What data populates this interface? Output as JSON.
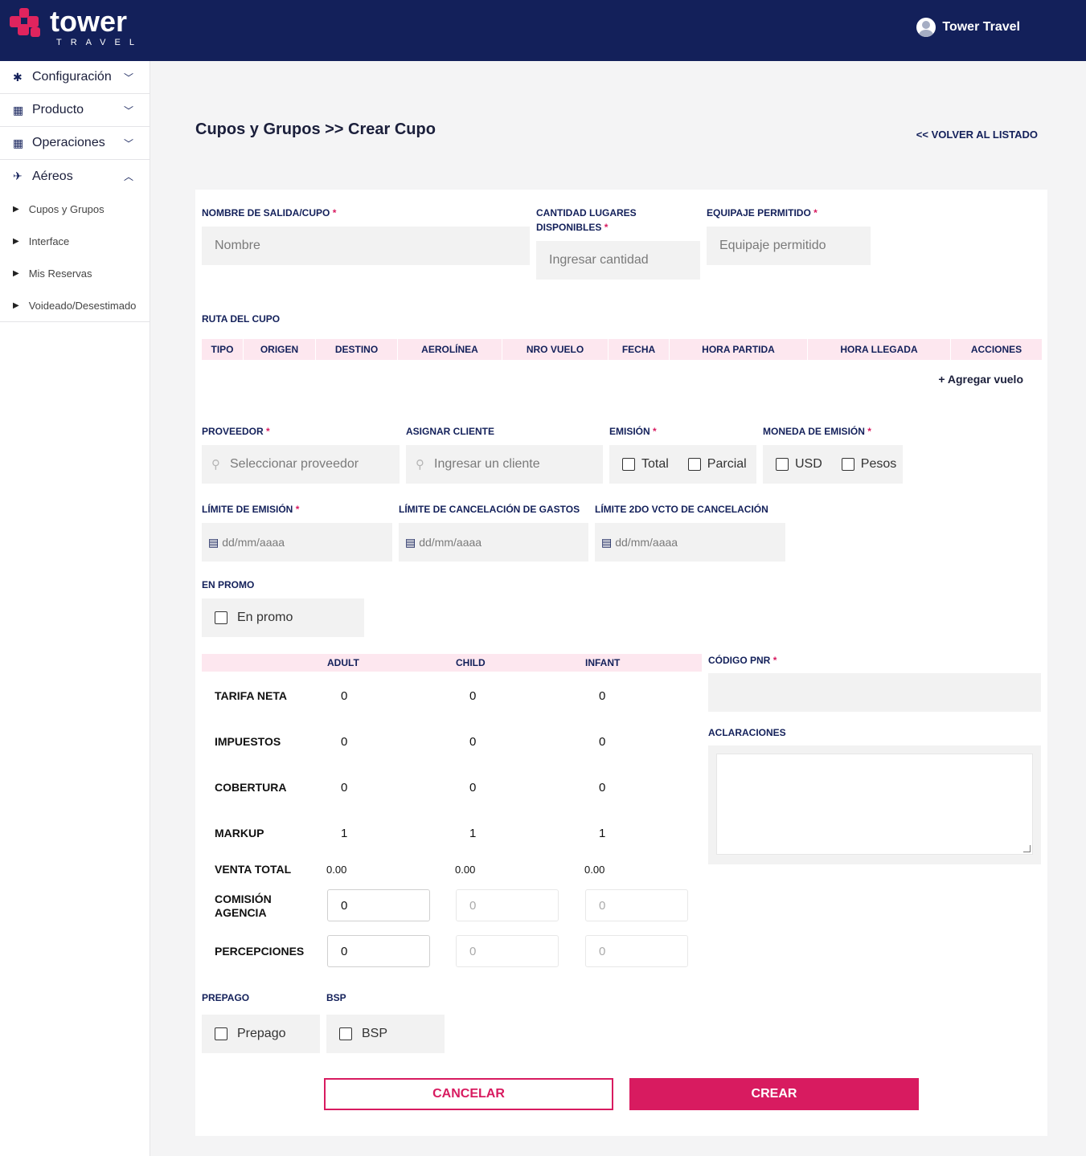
{
  "brand": {
    "name": "tower",
    "sub": "TRAVEL",
    "accent": "#d81b60",
    "nav_bg": "#13205a"
  },
  "user": {
    "name": "Tower Travel"
  },
  "sidebar": {
    "items": [
      {
        "label": "Configuración",
        "icon": "gear-icon"
      },
      {
        "label": "Producto",
        "icon": "grid-icon"
      },
      {
        "label": "Operaciones",
        "icon": "grid-icon"
      },
      {
        "label": "Aéreos",
        "icon": "plane-icon"
      }
    ],
    "sub_items": [
      "Cupos y Grupos",
      "Interface",
      "Mis Reservas",
      "Voideado/Desestimado"
    ]
  },
  "page": {
    "title": "Cupos y Grupos >> Crear Cupo",
    "back_link": "<< VOLVER AL LISTADO"
  },
  "form": {
    "nombre": {
      "label": "NOMBRE DE SALIDA/CUPO",
      "placeholder": "Nombre"
    },
    "cantidad": {
      "label_1": "CANTIDAD LUGARES",
      "label_2": "DISPONIBLES",
      "placeholder": "Ingresar cantidad"
    },
    "equipaje": {
      "label": "EQUIPAJE PERMITIDO",
      "placeholder": "Equipaje permitido"
    },
    "ruta": {
      "label": "RUTA DEL CUPO",
      "columns": [
        "TIPO",
        "ORIGEN",
        "DESTINO",
        "AEROLÍNEA",
        "NRO VUELO",
        "FECHA",
        "HORA PARTIDA",
        "HORA LLEGADA",
        "ACCIONES"
      ],
      "add_label": "+ Agregar vuelo"
    },
    "proveedor": {
      "label": "PROVEEDOR",
      "placeholder": "Seleccionar proveedor"
    },
    "cliente": {
      "label": "ASIGNAR CLIENTE",
      "placeholder": "Ingresar un cliente"
    },
    "emision": {
      "label": "EMISIÓN",
      "options": [
        "Total",
        "Parcial"
      ]
    },
    "moneda": {
      "label": "MONEDA DE EMISIÓN",
      "options": [
        "USD",
        "Pesos"
      ]
    },
    "limite_emision": {
      "label": "LÍMITE DE EMISIÓN",
      "placeholder": "dd/mm/aaaa"
    },
    "limite_cancel": {
      "label": "LÍMITE DE CANCELACIÓN DE GASTOS",
      "placeholder": "dd/mm/aaaa"
    },
    "limite_2do": {
      "label": "LÍMITE 2DO VCTO DE CANCELACIÓN",
      "placeholder": "dd/mm/aaaa"
    },
    "promo": {
      "label": "EN PROMO",
      "option": "En promo"
    },
    "fares": {
      "columns": [
        "ADULT",
        "CHILD",
        "INFANT"
      ],
      "rows": [
        {
          "label": "TARIFA NETA",
          "values": [
            "0",
            "0",
            "0"
          ]
        },
        {
          "label": "IMPUESTOS",
          "values": [
            "0",
            "0",
            "0"
          ]
        },
        {
          "label": "COBERTURA",
          "values": [
            "0",
            "0",
            "0"
          ]
        },
        {
          "label": "MARKUP",
          "values": [
            "1",
            "1",
            "1"
          ]
        },
        {
          "label": "VENTA TOTAL",
          "values": [
            "0.00",
            "0.00",
            "0.00"
          ]
        }
      ],
      "comision": {
        "label_1": "COMISIÓN",
        "label_2": "AGENCIA",
        "values": [
          "0",
          "0",
          "0"
        ]
      },
      "percepciones": {
        "label": "PERCEPCIONES",
        "values": [
          "0",
          "0",
          "0"
        ]
      }
    },
    "pnr": {
      "label": "CÓDIGO PNR"
    },
    "aclaraciones": {
      "label": "ACLARACIONES"
    },
    "prepago": {
      "label": "PREPAGO",
      "option": "Prepago"
    },
    "bsp": {
      "label": "BSP",
      "option": "BSP"
    },
    "cancel_label": "CANCELAR",
    "create_label": "CREAR"
  }
}
